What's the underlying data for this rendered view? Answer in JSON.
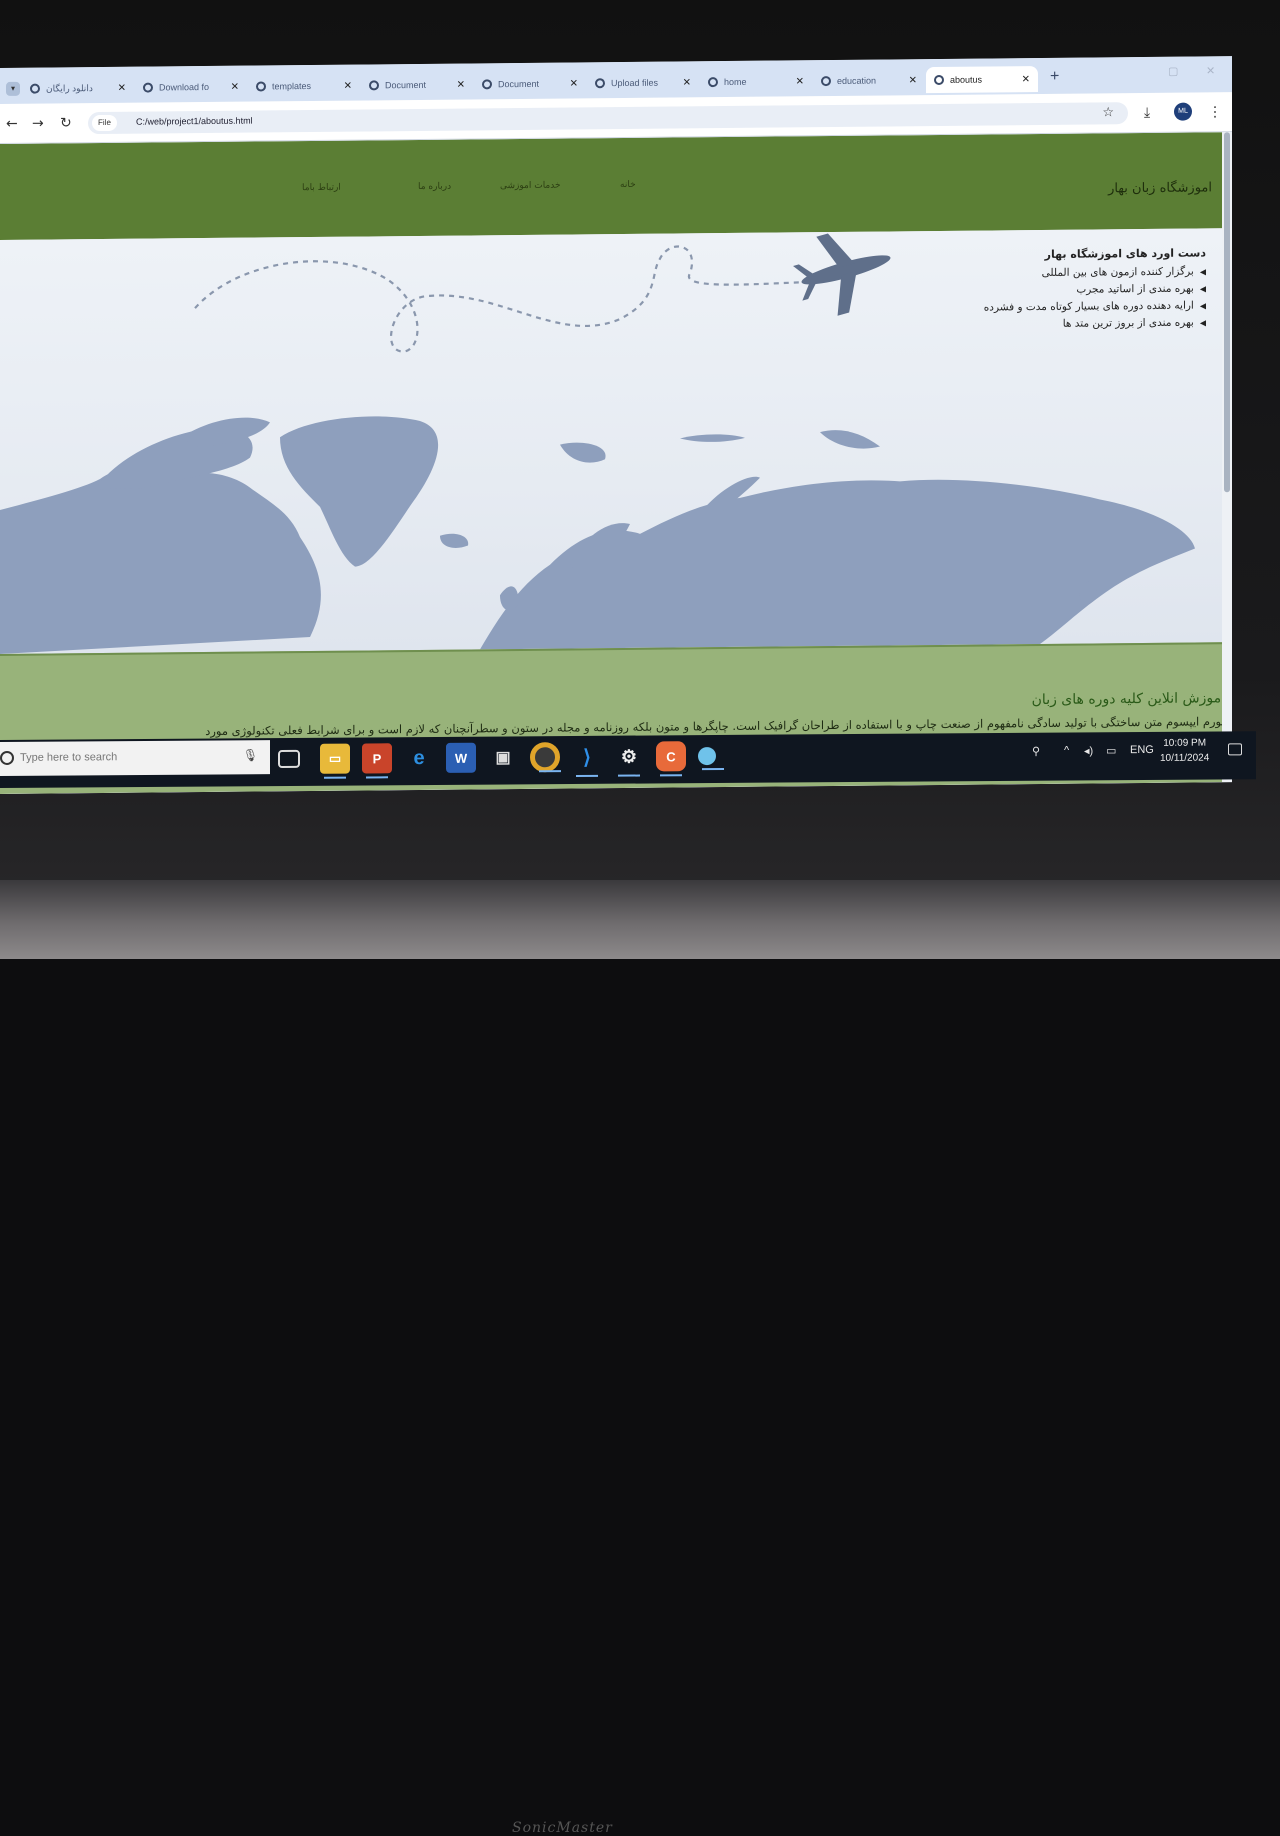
{
  "browser": {
    "tabs": [
      {
        "label": "دانلود رایگان"
      },
      {
        "label": "Download fo"
      },
      {
        "label": "templates"
      },
      {
        "label": "Document"
      },
      {
        "label": "Document"
      },
      {
        "label": "Upload files"
      },
      {
        "label": "home"
      },
      {
        "label": "education"
      },
      {
        "label": "aboutus"
      }
    ],
    "active_tab_index": 8,
    "file_chip": "File",
    "url": "C:/web/project1/aboutus.html",
    "profile_initials": "ML"
  },
  "site": {
    "title": "اموزشگاه زبان بهار",
    "nav": [
      {
        "label": "خانه"
      },
      {
        "label": "خدمات اموزشی"
      },
      {
        "label": "درباره ما"
      },
      {
        "label": "ارتباط باما"
      }
    ]
  },
  "achievements": {
    "heading": "دست اورد های اموزشگاه بهار",
    "items": [
      "برگزار کننده ازمون های بین المللی",
      "بهره مندی از اساتید مجرب",
      "ارایه دهنده دوره های بسیار کوتاه مدت و فشرده",
      "بهره مندی از بروز ترین متد ها"
    ]
  },
  "course": {
    "heading": "اموزش انلاین کلیه دوره های زبان",
    "text": "لورم ایپسوم متن ساختگی با تولید سادگی نامفهوم از صنعت چاپ و با استفاده از طراحان گرافیک است. چاپگرها و متون بلکه روزنامه و مجله در ستون و سطرآنچنان که لازم است و برای شرایط فعلی تکنولوژی مورد"
  },
  "taskbar": {
    "search_placeholder": "Type here to search",
    "language": "ENG",
    "time": "10:09 PM",
    "date": "10/11/2024"
  },
  "colors": {
    "header_green": "#5b7e34",
    "course_green": "#98b37a",
    "map_blue": "#8e9fbd"
  }
}
